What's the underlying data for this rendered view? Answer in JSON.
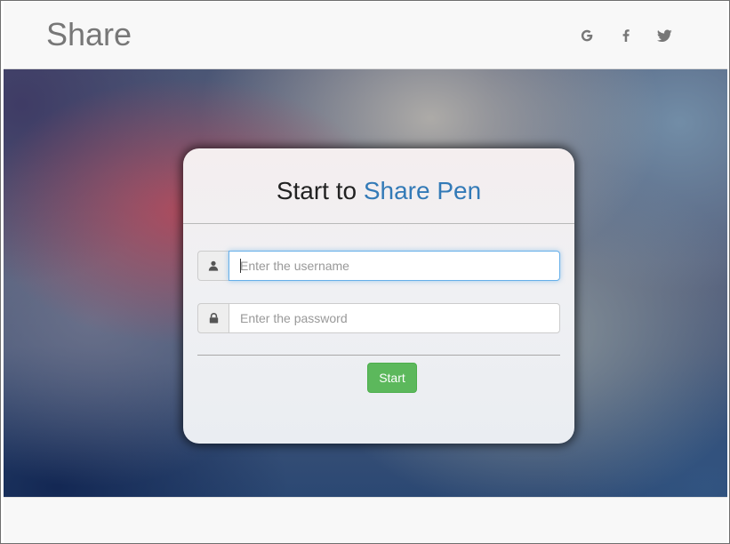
{
  "navbar": {
    "brand": "Share",
    "social": [
      {
        "name": "google",
        "glyph": "G"
      },
      {
        "name": "facebook",
        "glyph": "f"
      },
      {
        "name": "twitter",
        "icon": "twitter-bird-icon"
      }
    ],
    "icon_color": "#777777"
  },
  "login": {
    "title_prefix": "Start to ",
    "title_accent": "Share Pen",
    "accent_color": "#337ab7",
    "username": {
      "placeholder": "Enter the username",
      "value": "",
      "icon": "user-icon",
      "focused": true
    },
    "password": {
      "placeholder": "Enter the password",
      "value": "",
      "icon": "lock-icon"
    },
    "submit_label": "Start",
    "submit_color": "#5cb85c"
  }
}
